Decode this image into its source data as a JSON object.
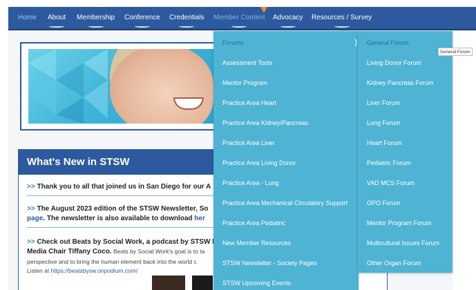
{
  "nav": {
    "items": [
      {
        "label": "Home"
      },
      {
        "label": "About"
      },
      {
        "label": "Membership"
      },
      {
        "label": "Conference"
      },
      {
        "label": "Credentials"
      },
      {
        "label": "Member Content"
      },
      {
        "label": "Advocacy"
      },
      {
        "label": "Resources / Survey"
      }
    ]
  },
  "news": {
    "title": "What's New in STSW",
    "item1": {
      "arrow": ">>",
      "text": "Thank you to all that joined us in San Diego for our A"
    },
    "item2": {
      "arrow": ">>",
      "line1": "The August 2023 edition of the STSW Newsletter, So",
      "line2_link": "page",
      "line2_text": ".  The newsletter is also available to download ",
      "line2_link2": "her"
    },
    "item3": {
      "arrow": ">>",
      "line1": "Check out Beats by Social Work, a podcast by STSW M",
      "line2_bold": "Media Chair Tiffany Coco.",
      "line2_small": "  Beats by Social Work's goal is to ta",
      "line3": "perspective and to bring the human element back into the world c",
      "line4_prefix": "Listen at ",
      "line4_link": "https://beatsbysw.onpodium.com/"
    }
  },
  "menu_member_content": {
    "items": [
      "Forums",
      "Assessment Tools",
      "Mentor Program",
      "Practice Area Heart",
      "Practice Area Kidney/Pancreas",
      "Practice Area Liver",
      "Practice Area Living Donor",
      "Practice Area - Lung",
      "Practice Area Mechanical Circulatory Support",
      "Practice Area Pediatric",
      "New Member Resources",
      "STSW Newsletter - Society Pages",
      "STSW Upcoming Events"
    ]
  },
  "menu_forums": {
    "items": [
      "General Forum",
      "Living Donor Forum",
      "Kidney Pancreas Forum",
      "Liver Forum",
      "Lung Forum",
      "Heart Forum",
      "Pediatric Forum",
      "VAD MCS Forum",
      "OPO Forum",
      "Mentor Program Forum",
      "Multicultural Issues Forum",
      "Other Organ Forum"
    ],
    "caret": ")"
  },
  "tooltip": "General Forum"
}
